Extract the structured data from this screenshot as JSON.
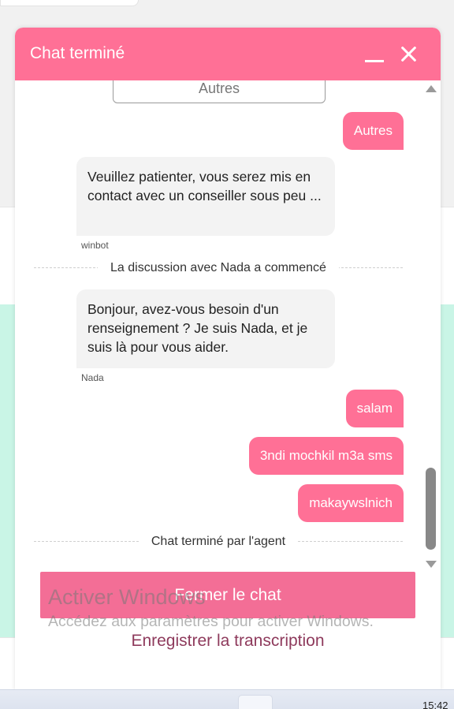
{
  "chat": {
    "title": "Chat terminé",
    "choice_button": "Autres",
    "messages": [
      {
        "type": "user",
        "text": "Autres"
      },
      {
        "type": "bot",
        "text": "Veuillez patienter, vous serez mis en contact avec un conseiller sous peu ...",
        "sender": "winbot"
      },
      {
        "type": "system",
        "text": "La discussion avec Nada a commencé"
      },
      {
        "type": "bot",
        "text": "Bonjour, avez-vous besoin d'un renseignement ? Je suis Nada, et je suis là pour vous aider.",
        "sender": "Nada"
      },
      {
        "type": "user",
        "text": "salam"
      },
      {
        "type": "user",
        "text": "3ndi mochkil m3a sms"
      },
      {
        "type": "user",
        "text": "makaywslnich"
      },
      {
        "type": "system",
        "text": "Chat terminé par l'agent"
      }
    ],
    "close_button": "Fermer le chat",
    "save_transcript": "Enregistrer la transcription"
  },
  "watermark": {
    "title": "Activer Windows",
    "subtitle": "Accédez aux paramètres pour activer Windows."
  },
  "taskbar": {
    "clock": "15:42"
  },
  "colors": {
    "accent": "#ff7096",
    "button": "#f36e96",
    "link": "#8e3a5c",
    "bot_bubble": "#f3f3f3",
    "background_mint": "#c9f5e6"
  },
  "icons": {
    "minimize": "minimize-icon",
    "close": "close-icon",
    "scroll_up": "scroll-up-icon",
    "scroll_down": "scroll-down-icon"
  }
}
